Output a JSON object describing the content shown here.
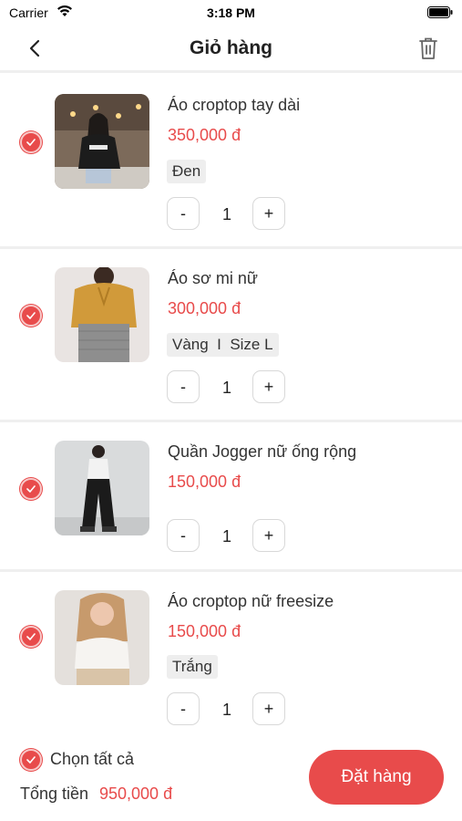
{
  "status_bar": {
    "carrier": "Carrier",
    "time": "3:18 PM"
  },
  "header": {
    "title": "Giỏ hàng"
  },
  "cart": {
    "items": [
      {
        "name": "Áo croptop tay dài",
        "price": "350,000 đ",
        "variant": "Đen",
        "quantity": "1",
        "selected": true
      },
      {
        "name": "Áo sơ mi nữ",
        "price": "300,000 đ",
        "variant": "Vàng  I  Size L",
        "quantity": "1",
        "selected": true
      },
      {
        "name": "Quần Jogger nữ ống rộng",
        "price": "150,000 đ",
        "variant": "",
        "quantity": "1",
        "selected": true
      },
      {
        "name": "Áo croptop nữ freesize",
        "price": "150,000 đ",
        "variant": "Trắng",
        "quantity": "1",
        "selected": true
      }
    ],
    "minus_label": "-",
    "plus_label": "+"
  },
  "footer": {
    "select_all_label": "Chọn tất cả",
    "total_label": "Tổng tiền",
    "total_value": "950,000 đ",
    "order_button_label": "Đặt hàng"
  },
  "colors": {
    "accent": "#e84b4b",
    "divider": "#efefef",
    "tag_bg": "#eeeeee"
  }
}
